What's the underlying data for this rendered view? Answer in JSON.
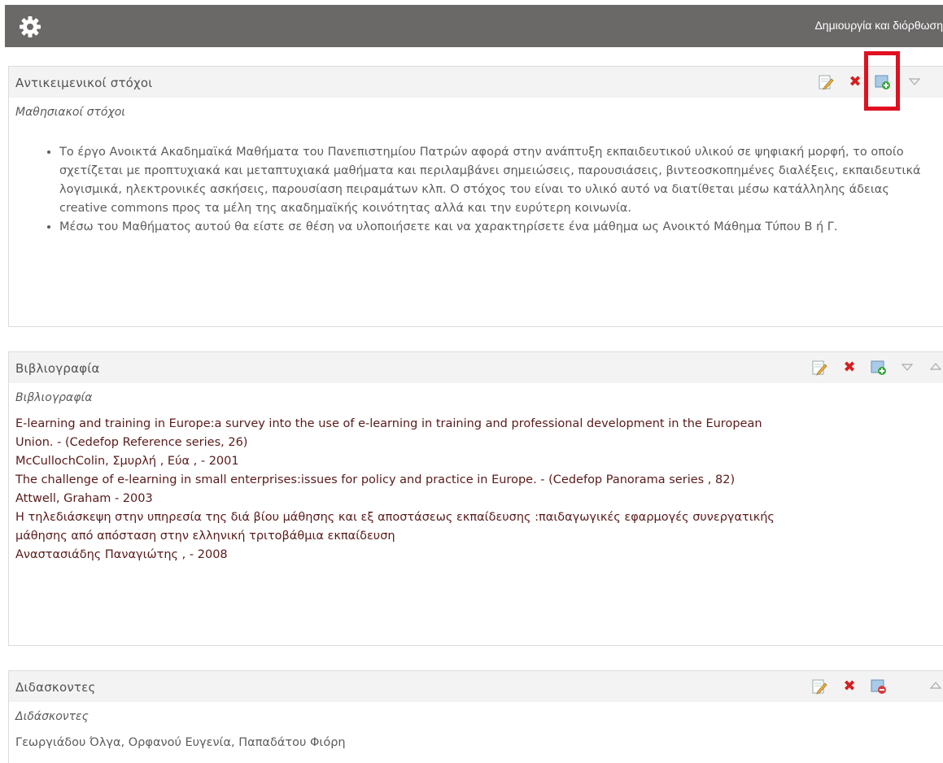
{
  "topbar": {
    "title": "Δημιουργία και διόρθωση",
    "icon": "gear-icon"
  },
  "sections": [
    {
      "title": "Αντικειμενικοί στόχοι",
      "subtitle": "Μαθησιακοί στόχοι",
      "actions": [
        "edit-icon",
        "delete-icon",
        "add-resource-icon",
        "move-down-icon"
      ],
      "bullets": [
        "Το έργο Ανοικτά Ακαδημαϊκά Μαθήματα του Πανεπιστημίου Πατρών αφορά στην ανάπτυξη εκπαιδευτικού υλικού σε ψηφιακή μορφή, το οποίο σχετίζεται με προπτυχιακά και μεταπτυχιακά μαθήματα και περιλαμβάνει σημειώσεις, παρουσιάσεις, βιντεοσκοπημένες διαλέξεις, εκπαιδευτικά λογισμικά, ηλεκτρονικές ασκήσεις, παρουσίαση πειραμάτων κλπ. Ο στόχος του είναι το υλικό αυτό να διατίθεται μέσω κατάλληλης άδειας creative commons προς τα μέλη της ακαδημαϊκής κοινότητας αλλά και την ευρύτερη κοινωνία.",
        "Μέσω του Μαθήματος αυτού θα είστε σε θέση να υλοποιήσετε και να χαρακτηρίσετε ένα μάθημα ως Ανοικτό Μάθημα Τύπου Β ή Γ."
      ]
    },
    {
      "title": "Βιβλιογραφία",
      "subtitle": "Βιβλιογραφία",
      "actions": [
        "edit-icon",
        "delete-icon",
        "add-resource-icon",
        "move-down-icon",
        "move-up-icon"
      ],
      "lines": [
        "E-learning and training in Europe:a survey into the use of e-learning in training and professional development in the European",
        "Union. - (Cedefop Reference series, 26)",
        "McCullochColin, Σμυρλή , Εύα , - 2001",
        "The challenge of e-learning in small enterprises:issues for policy and practice in Europe. - (Cedefop Panorama series , 82)",
        "Attwell, Graham - 2003",
        "Η τηλεδιάσκεψη στην υπηρεσία της διά βίου μάθησης και εξ αποστάσεως εκπαίδευσης :παιδαγωγικές εφαρμογές συνεργατικής",
        "μάθησης από απόσταση στην ελληνική τριτοβάθμια εκπαίδευση",
        "Αναστασιάδης Παναγιώτης , - 2008"
      ]
    },
    {
      "title": "Διδασκοντες",
      "subtitle": "Διδάσκοντες",
      "actions": [
        "edit-icon",
        "delete-icon",
        "remove-resource-icon",
        "move-up-icon"
      ],
      "text": "Γεωργιάδου Όλγα, Ορφανού Ευγενία, Παπαδάτου Φιόρη"
    }
  ],
  "colors": {
    "topbar": "#6b6868",
    "header_bg": "#f3f3f3",
    "highlight": "#e01020",
    "biblio_text": "#5a1a1a"
  }
}
